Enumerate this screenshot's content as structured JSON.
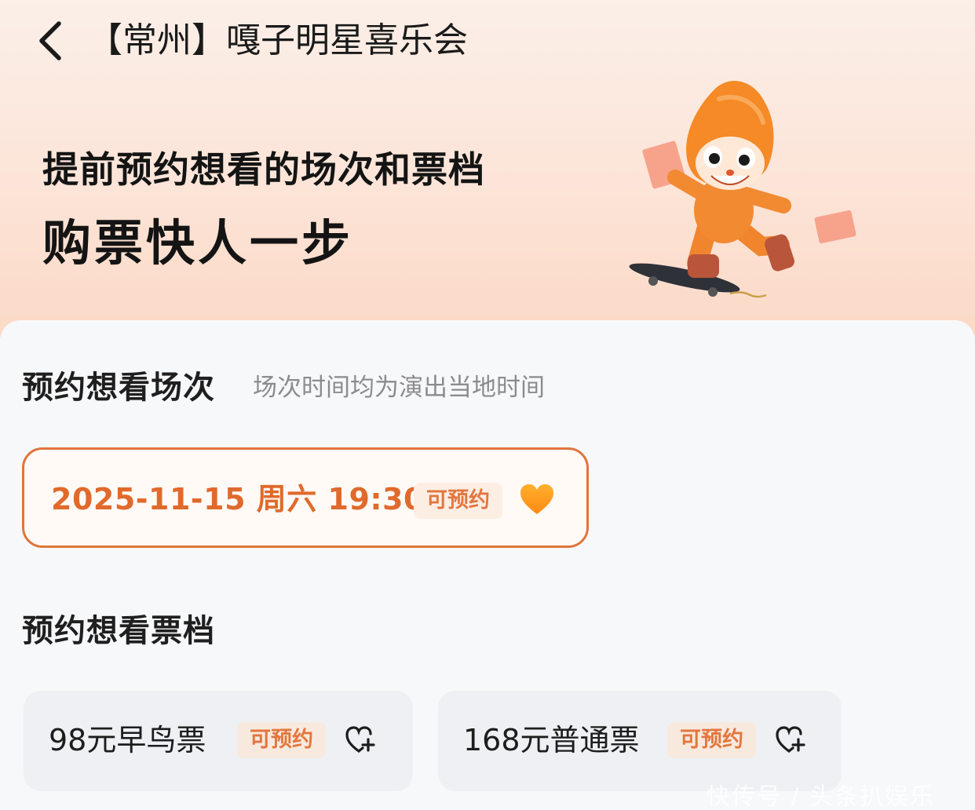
{
  "header": {
    "title": "【常州】嘎子明星喜乐会"
  },
  "hero": {
    "line1": "提前预约想看的场次和票档",
    "line2": "购票快人一步"
  },
  "sessions": {
    "title": "预约想看场次",
    "subtitle": "场次时间均为演出当地时间",
    "items": [
      {
        "datetime": "2025-11-15 周六 19:30",
        "badge": "可预约",
        "selected": true
      }
    ]
  },
  "tiers": {
    "title": "预约想看票档",
    "items": [
      {
        "label": "98元早鸟票",
        "badge": "可预约"
      },
      {
        "label": "168元普通票",
        "badge": "可预约"
      }
    ]
  },
  "watermark": "快传号 / 头条扒娱乐",
  "colors": {
    "accent": "#e06a2c",
    "badge_bg": "#fdeee4",
    "hero_bg": "#fce3d6",
    "card_bg": "#f7f8fa"
  },
  "icons": {
    "back": "chevron-left-icon",
    "favorite_filled": "heart-filled-icon",
    "favorite_add": "heart-plus-icon"
  }
}
